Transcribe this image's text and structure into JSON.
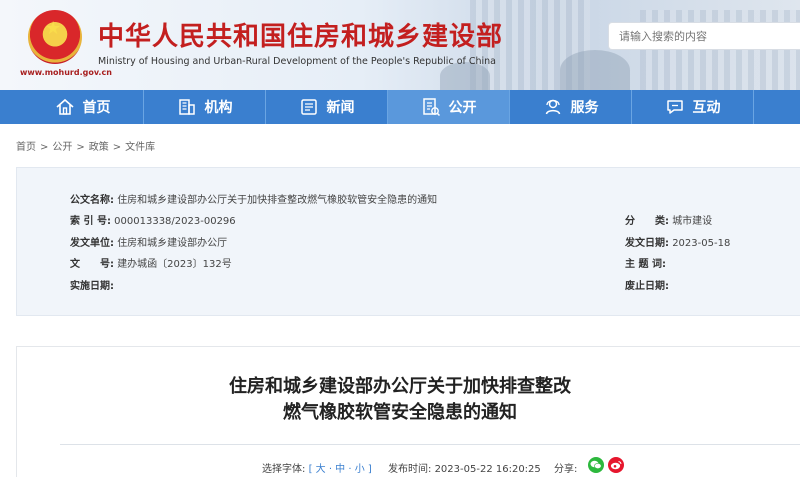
{
  "header": {
    "title": "中华人民共和国住房和城乡建设部",
    "subtitle": "Ministry of Housing and Urban-Rural Development of the People's Republic of China",
    "url": "www.mohurd.gov.cn",
    "search_placeholder": "请输入搜索的内容"
  },
  "nav": {
    "items": [
      {
        "label": "首页",
        "icon": "home-icon"
      },
      {
        "label": "机构",
        "icon": "building-icon"
      },
      {
        "label": "新闻",
        "icon": "news-icon"
      },
      {
        "label": "公开",
        "icon": "document-icon"
      },
      {
        "label": "服务",
        "icon": "service-icon"
      },
      {
        "label": "互动",
        "icon": "chat-icon"
      }
    ],
    "active": "公开"
  },
  "breadcrumb": {
    "items": [
      "首页",
      "公开",
      "政策",
      "文件库"
    ],
    "separator": ">"
  },
  "meta": {
    "name_label": "公文名称:",
    "name_value": "住房和城乡建设部办公厅关于加快排查整改燃气橡胶软管安全隐患的通知",
    "index_label": "索 引 号:",
    "index_value": "000013338/2023-00296",
    "category_label": "分　　类:",
    "category_value": "城市建设",
    "issuer_label": "发文单位:",
    "issuer_value": "住房和城乡建设部办公厅",
    "date_label": "发文日期:",
    "date_value": "2023-05-18",
    "docno_label": "文　　号:",
    "docno_value": "建办城函〔2023〕132号",
    "topic_label": "主 题 词:",
    "topic_value": "",
    "effective_label": "实施日期:",
    "effective_value": "",
    "expire_label": "废止日期:",
    "expire_value": ""
  },
  "article": {
    "title_line1": "住房和城乡建设部办公厅关于加快排查整改",
    "title_line2": "燃气橡胶软管安全隐患的通知",
    "font_label": "选择字体:",
    "font_options": "[ 大 · 中 · 小 ]",
    "publish_label": "发布时间:",
    "publish_time": "2023-05-22 16:20:25",
    "share_label": "分享:"
  },
  "colors": {
    "nav_bg": "#3a7fcf",
    "nav_active": "#5a98dc",
    "title_red": "#c31f1f",
    "wechat": "#2db83d",
    "weibo": "#e6162d"
  }
}
